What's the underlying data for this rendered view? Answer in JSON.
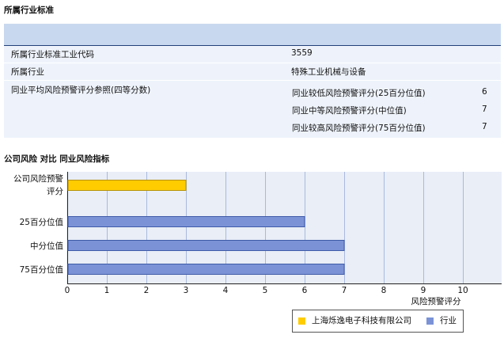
{
  "section1": {
    "title": "所属行业标准",
    "rows": {
      "code_label": "所属行业标准工业代码",
      "code_value": "3559",
      "industry_label": "所属行业",
      "industry_value": "特殊工业机械与设备",
      "peer_label": "同业平均风险预警评分参照(四等分数)"
    },
    "peer": [
      {
        "label": "同业较低风险预警评分(25百分位值)",
        "value": "6"
      },
      {
        "label": "同业中等风险预警评分(中位值)",
        "value": "7"
      },
      {
        "label": "同业较高风险预警评分(75百分位值)",
        "value": "7"
      }
    ]
  },
  "section2": {
    "title": "公司风险 对比 同业风险指标"
  },
  "chart_data": {
    "type": "bar",
    "orientation": "horizontal",
    "categories": [
      "公司风险预警评分",
      "25百分位值",
      "中分位值",
      "75百分位值"
    ],
    "category_lines": [
      [
        "公司风险预警",
        "评分"
      ],
      [
        "25百分位值"
      ],
      [
        "中分位值"
      ],
      [
        "75百分位值"
      ]
    ],
    "values": [
      3,
      6,
      7,
      7
    ],
    "bar_series": [
      "company",
      "industry",
      "industry",
      "industry"
    ],
    "series": [
      {
        "name": "上海烁逸电子科技有限公司",
        "color": "#ffcc00"
      },
      {
        "name": "行业",
        "color": "#7b93d6"
      }
    ],
    "xlim": [
      0,
      11
    ],
    "xticks": [
      0,
      1,
      2,
      3,
      4,
      5,
      6,
      7,
      8,
      9,
      10
    ],
    "xlabel": "风险预警评分",
    "grid": true,
    "legend_position": "bottom-right"
  }
}
